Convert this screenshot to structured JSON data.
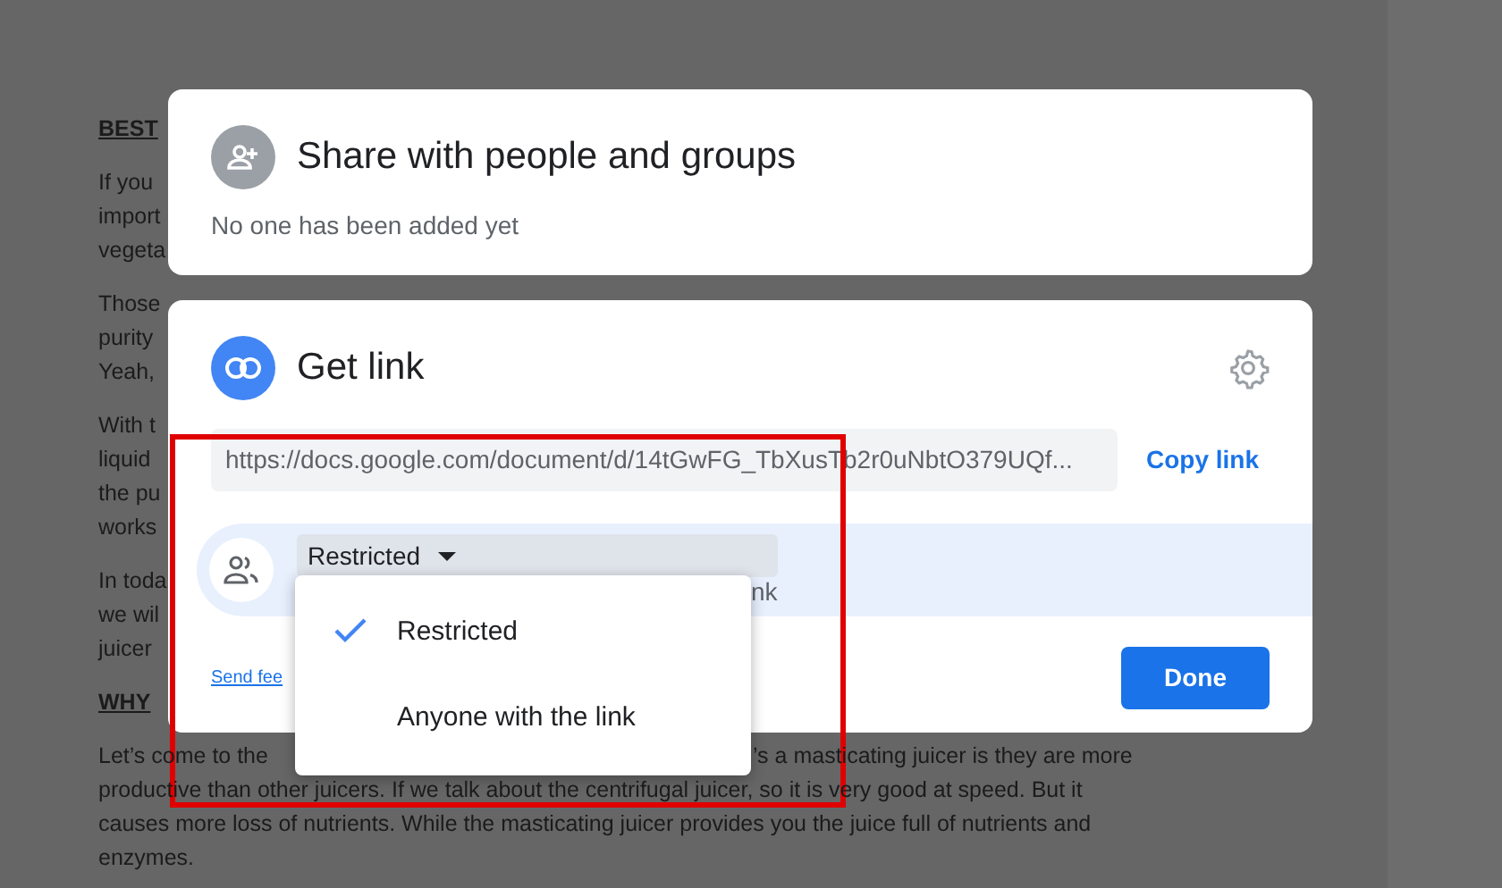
{
  "document": {
    "paragraphs": [
      {
        "kind": "heading",
        "lines": [
          {
            "text": "BEST"
          }
        ]
      },
      {
        "kind": "body",
        "lines": [
          {
            "text": "If you"
          },
          {
            "text": "import"
          },
          {
            "text": "vegeta"
          }
        ]
      },
      {
        "kind": "body",
        "lines": [
          {
            "text": "Those"
          },
          {
            "text": "purity"
          },
          {
            "text": "Yeah,"
          }
        ]
      },
      {
        "kind": "body",
        "lines": [
          {
            "text": "With t"
          },
          {
            "text": "liquid"
          },
          {
            "text": "the pu"
          },
          {
            "text": "works"
          }
        ]
      },
      {
        "kind": "body",
        "lines": [
          {
            "text": "In toda"
          },
          {
            "text": "we wil"
          },
          {
            "text": "juicer"
          }
        ]
      },
      {
        "kind": "heading",
        "lines": [
          {
            "text": "WHY"
          }
        ]
      },
      {
        "kind": "body",
        "lines": [
          {
            "text": "Let’s come to the",
            "text_right": "’s a masticating juicer is they are more"
          },
          {
            "text": "productive than other juicers. If we talk about the centrifugal juicer, so it is very good at speed. But it"
          },
          {
            "text": "causes more loss of nutrients. While the masticating juicer provides you the juice full of nutrients and"
          },
          {
            "text": "enzymes."
          }
        ]
      }
    ]
  },
  "share_card": {
    "title": "Share with people and groups",
    "subtitle": "No one has been added yet"
  },
  "link_card": {
    "title": "Get link",
    "url": "https://docs.google.com/document/d/14tGwFG_TbXusTb2r0uNbtO379UQf...",
    "copy_button": "Copy link",
    "access_dropdown": "Restricted",
    "access_description": "nk",
    "feedback_link": "Send fee",
    "done_button": "Done"
  },
  "access_menu": {
    "items": [
      {
        "label": "Restricted",
        "selected": true
      },
      {
        "label": "Anyone with the link",
        "selected": false
      }
    ]
  }
}
